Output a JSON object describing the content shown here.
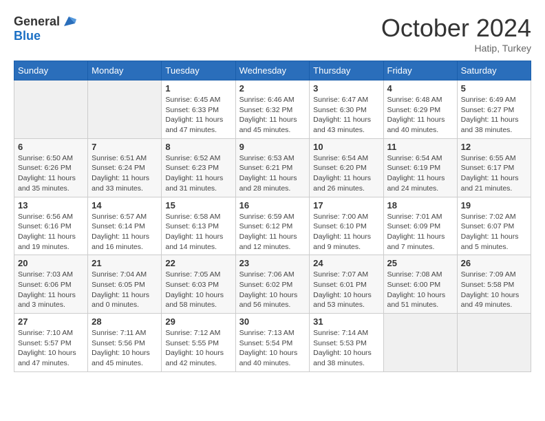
{
  "logo": {
    "general": "General",
    "blue": "Blue"
  },
  "header": {
    "month": "October 2024",
    "location": "Hatip, Turkey"
  },
  "weekdays": [
    "Sunday",
    "Monday",
    "Tuesday",
    "Wednesday",
    "Thursday",
    "Friday",
    "Saturday"
  ],
  "weeks": [
    [
      {
        "day": "",
        "info": ""
      },
      {
        "day": "",
        "info": ""
      },
      {
        "day": "1",
        "info": "Sunrise: 6:45 AM\nSunset: 6:33 PM\nDaylight: 11 hours and 47 minutes."
      },
      {
        "day": "2",
        "info": "Sunrise: 6:46 AM\nSunset: 6:32 PM\nDaylight: 11 hours and 45 minutes."
      },
      {
        "day": "3",
        "info": "Sunrise: 6:47 AM\nSunset: 6:30 PM\nDaylight: 11 hours and 43 minutes."
      },
      {
        "day": "4",
        "info": "Sunrise: 6:48 AM\nSunset: 6:29 PM\nDaylight: 11 hours and 40 minutes."
      },
      {
        "day": "5",
        "info": "Sunrise: 6:49 AM\nSunset: 6:27 PM\nDaylight: 11 hours and 38 minutes."
      }
    ],
    [
      {
        "day": "6",
        "info": "Sunrise: 6:50 AM\nSunset: 6:26 PM\nDaylight: 11 hours and 35 minutes."
      },
      {
        "day": "7",
        "info": "Sunrise: 6:51 AM\nSunset: 6:24 PM\nDaylight: 11 hours and 33 minutes."
      },
      {
        "day": "8",
        "info": "Sunrise: 6:52 AM\nSunset: 6:23 PM\nDaylight: 11 hours and 31 minutes."
      },
      {
        "day": "9",
        "info": "Sunrise: 6:53 AM\nSunset: 6:21 PM\nDaylight: 11 hours and 28 minutes."
      },
      {
        "day": "10",
        "info": "Sunrise: 6:54 AM\nSunset: 6:20 PM\nDaylight: 11 hours and 26 minutes."
      },
      {
        "day": "11",
        "info": "Sunrise: 6:54 AM\nSunset: 6:19 PM\nDaylight: 11 hours and 24 minutes."
      },
      {
        "day": "12",
        "info": "Sunrise: 6:55 AM\nSunset: 6:17 PM\nDaylight: 11 hours and 21 minutes."
      }
    ],
    [
      {
        "day": "13",
        "info": "Sunrise: 6:56 AM\nSunset: 6:16 PM\nDaylight: 11 hours and 19 minutes."
      },
      {
        "day": "14",
        "info": "Sunrise: 6:57 AM\nSunset: 6:14 PM\nDaylight: 11 hours and 16 minutes."
      },
      {
        "day": "15",
        "info": "Sunrise: 6:58 AM\nSunset: 6:13 PM\nDaylight: 11 hours and 14 minutes."
      },
      {
        "day": "16",
        "info": "Sunrise: 6:59 AM\nSunset: 6:12 PM\nDaylight: 11 hours and 12 minutes."
      },
      {
        "day": "17",
        "info": "Sunrise: 7:00 AM\nSunset: 6:10 PM\nDaylight: 11 hours and 9 minutes."
      },
      {
        "day": "18",
        "info": "Sunrise: 7:01 AM\nSunset: 6:09 PM\nDaylight: 11 hours and 7 minutes."
      },
      {
        "day": "19",
        "info": "Sunrise: 7:02 AM\nSunset: 6:07 PM\nDaylight: 11 hours and 5 minutes."
      }
    ],
    [
      {
        "day": "20",
        "info": "Sunrise: 7:03 AM\nSunset: 6:06 PM\nDaylight: 11 hours and 3 minutes."
      },
      {
        "day": "21",
        "info": "Sunrise: 7:04 AM\nSunset: 6:05 PM\nDaylight: 11 hours and 0 minutes."
      },
      {
        "day": "22",
        "info": "Sunrise: 7:05 AM\nSunset: 6:03 PM\nDaylight: 10 hours and 58 minutes."
      },
      {
        "day": "23",
        "info": "Sunrise: 7:06 AM\nSunset: 6:02 PM\nDaylight: 10 hours and 56 minutes."
      },
      {
        "day": "24",
        "info": "Sunrise: 7:07 AM\nSunset: 6:01 PM\nDaylight: 10 hours and 53 minutes."
      },
      {
        "day": "25",
        "info": "Sunrise: 7:08 AM\nSunset: 6:00 PM\nDaylight: 10 hours and 51 minutes."
      },
      {
        "day": "26",
        "info": "Sunrise: 7:09 AM\nSunset: 5:58 PM\nDaylight: 10 hours and 49 minutes."
      }
    ],
    [
      {
        "day": "27",
        "info": "Sunrise: 7:10 AM\nSunset: 5:57 PM\nDaylight: 10 hours and 47 minutes."
      },
      {
        "day": "28",
        "info": "Sunrise: 7:11 AM\nSunset: 5:56 PM\nDaylight: 10 hours and 45 minutes."
      },
      {
        "day": "29",
        "info": "Sunrise: 7:12 AM\nSunset: 5:55 PM\nDaylight: 10 hours and 42 minutes."
      },
      {
        "day": "30",
        "info": "Sunrise: 7:13 AM\nSunset: 5:54 PM\nDaylight: 10 hours and 40 minutes."
      },
      {
        "day": "31",
        "info": "Sunrise: 7:14 AM\nSunset: 5:53 PM\nDaylight: 10 hours and 38 minutes."
      },
      {
        "day": "",
        "info": ""
      },
      {
        "day": "",
        "info": ""
      }
    ]
  ]
}
